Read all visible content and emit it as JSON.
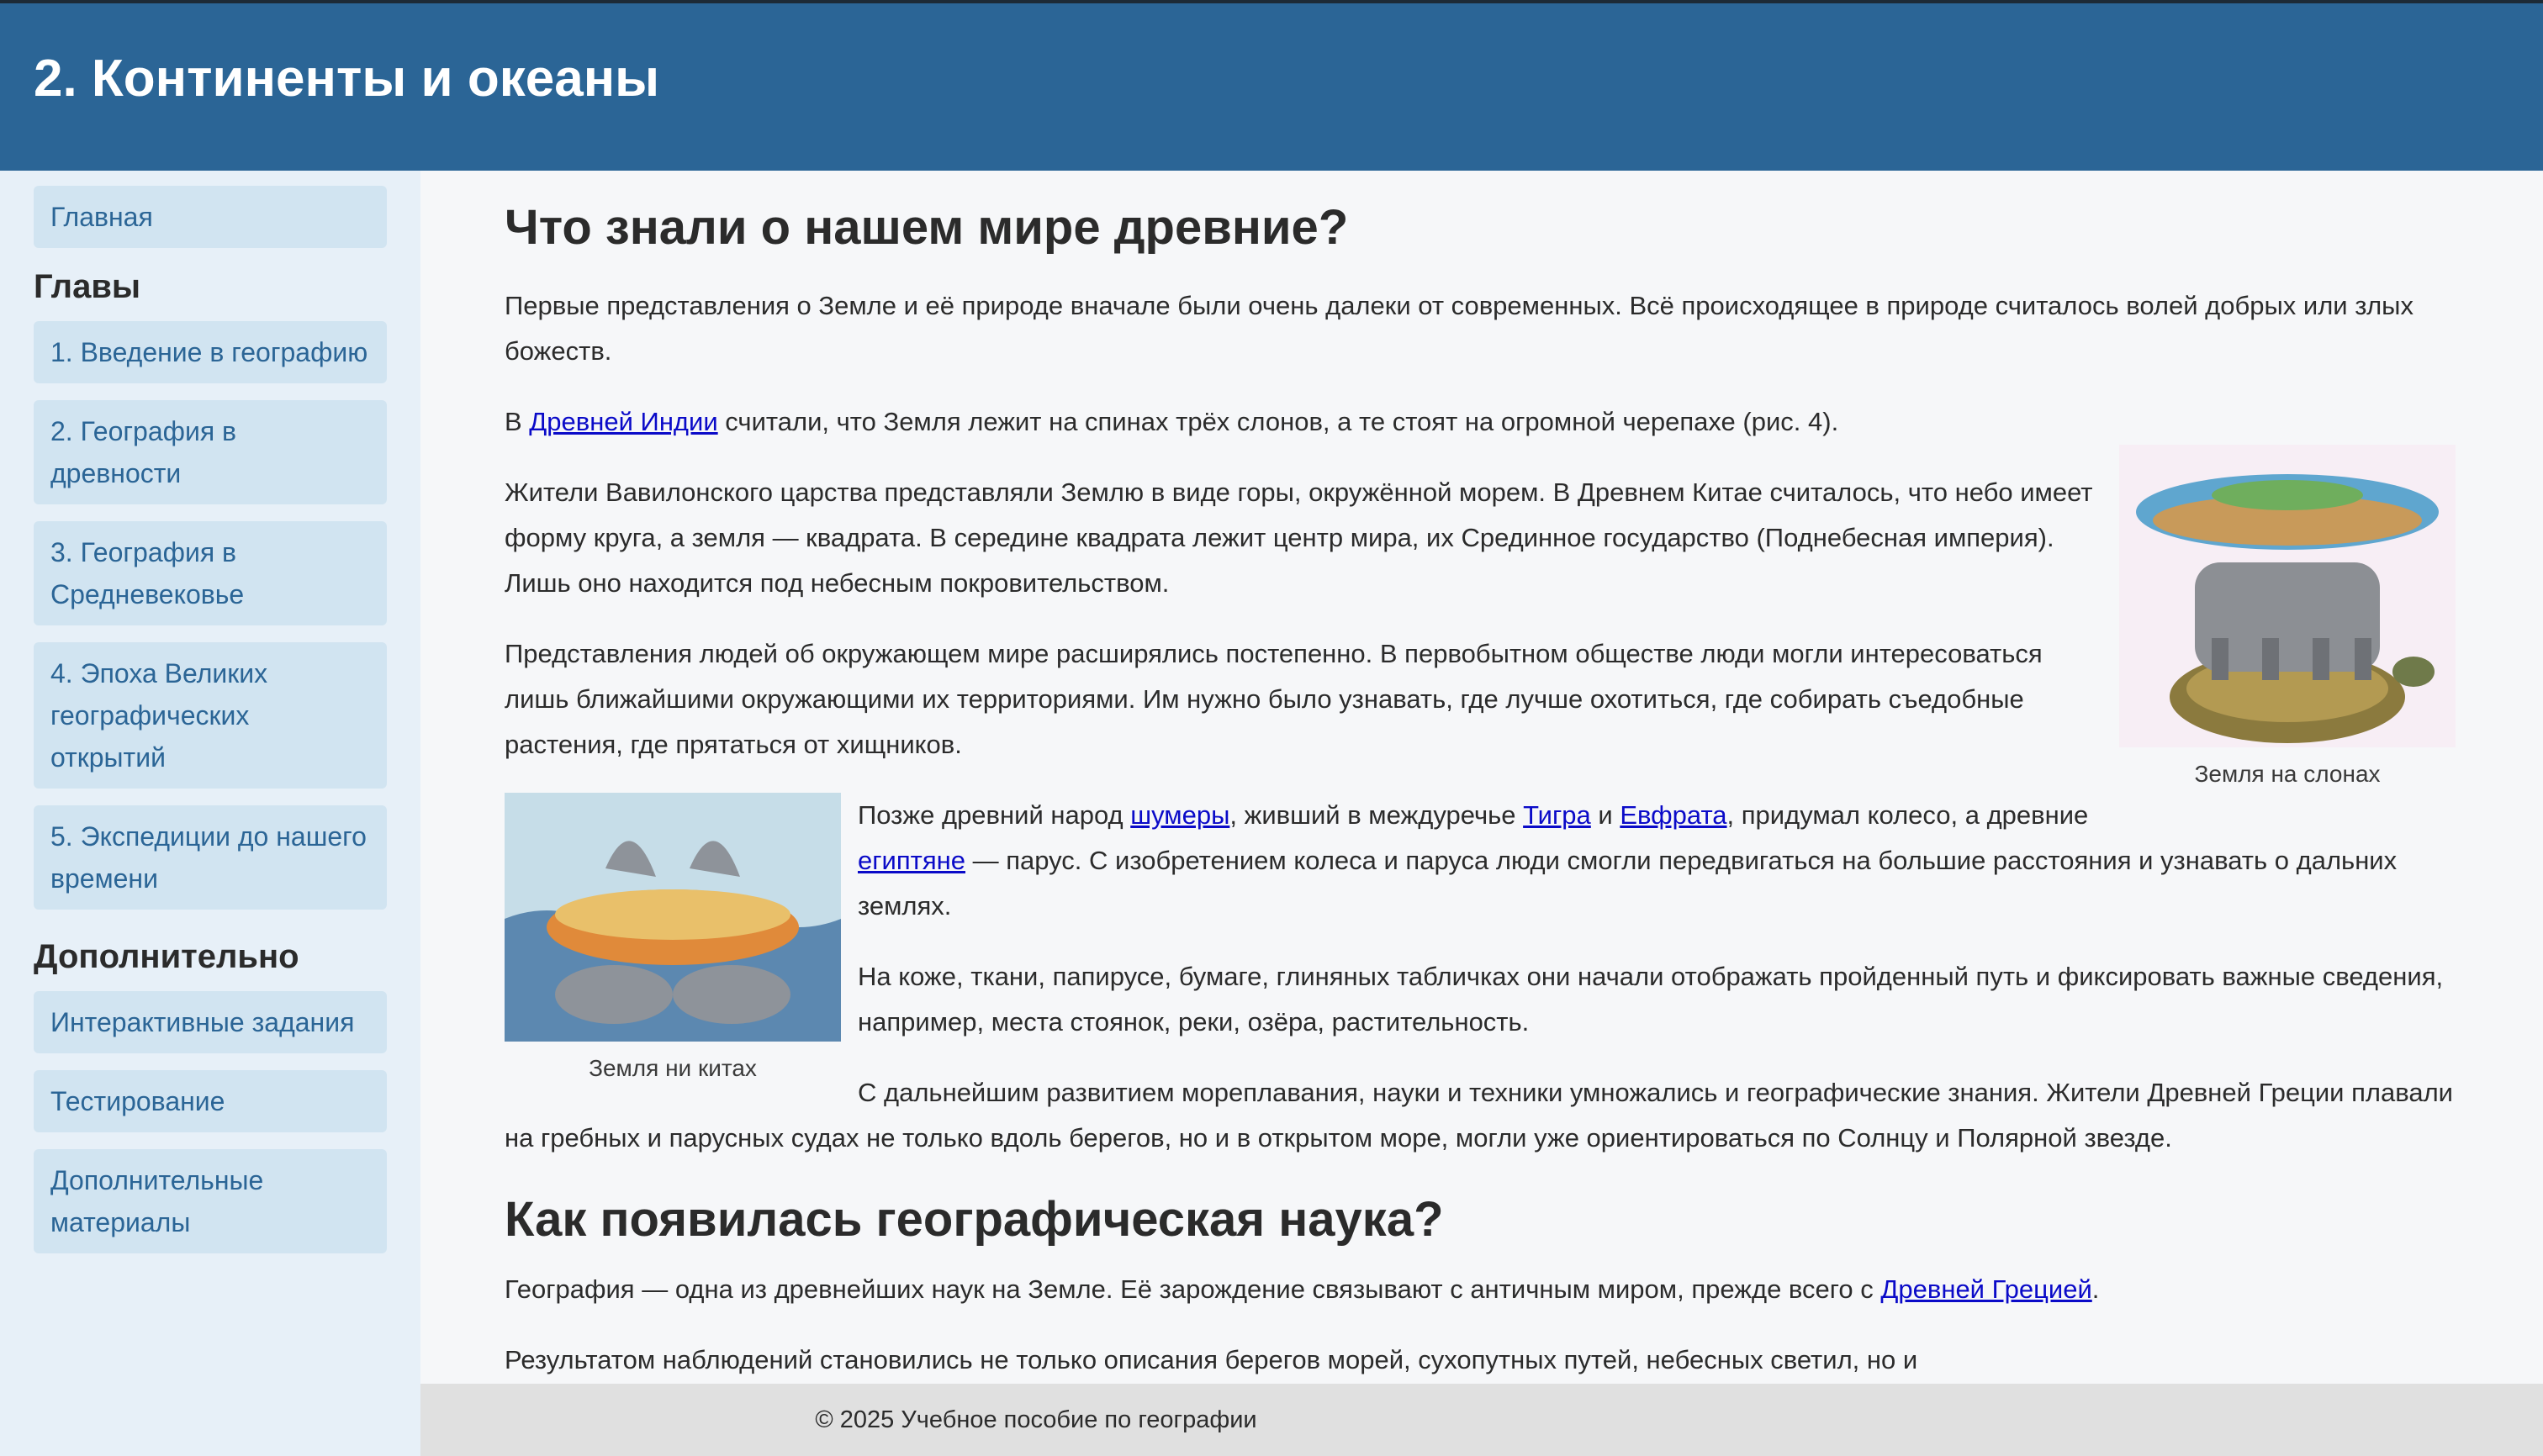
{
  "header": {
    "title": "2. Континенты и океаны"
  },
  "sidebar": {
    "home": "Главная",
    "chapters_heading": "Главы",
    "chapters": [
      "1. Введение в географию",
      "2. География в древности",
      "3. География в Средневековье",
      "4. Эпоха Великих географических открытий",
      "5. Экспедиции до нашего времени"
    ],
    "extra_heading": "Дополнительно",
    "extra": [
      "Интерактивные задания",
      "Тестирование",
      "Дополнительные материалы"
    ]
  },
  "main": {
    "h1": "Что знали о нашем мире древние?",
    "p1": "Первые представления о Земле и её природе вначале были очень далеки от современных. Всё происходящее в природе считалось волей добрых или злых божеств.",
    "p2_pre": "В ",
    "p2_link": "Древней Индии",
    "p2_post": " считали, что Земля лежит на спинах трёх слонов, а те стоят на огромной черепахе (рис. 4).",
    "fig1_caption": "Земля на слонах",
    "p3": "Жители Вавилонского царства представляли Землю в виде горы, окружённой морем. В Древнем Китае считалось, что небо имеет форму круга, а земля — квадрата. В середине квадрата лежит центр мира, их Срединное государство (Поднебесная империя). Лишь оно находится под небесным покровительством.",
    "p4": "Представления людей об окружающем мире расширялись постепенно. В первобытном обществе люди могли интересоваться лишь ближайшими окружающими их территориями. Им нужно было узнавать, где лучше охотиться, где собирать съедобные растения, где прятаться от хищников.",
    "fig2_caption": "Земля ни китах",
    "p5_a": "Позже древний народ ",
    "p5_link1": "шумеры",
    "p5_b": ", живший в междуречье ",
    "p5_link2": "Тигра",
    "p5_c": " и ",
    "p5_link3": "Евфрата",
    "p5_d": ", придумал колесо, а древние ",
    "p5_link4": "египтяне",
    "p5_e": " — парус. С изобретением колеса и паруса люди смогли передвигаться на большие расстояния и узнавать о дальних землях.",
    "p6": "На коже, ткани, папирусе, бумаге, глиняных табличках они начали отображать пройденный путь и фиксировать важные сведения, например, места стоянок, реки, озёра, растительность.",
    "p7": "С дальнейшим развитием мореплавания, науки и техники умножались и географические знания. Жители Древней Греции плавали на гребных и парусных судах не только вдоль берегов, но и в открытом море, могли уже ориентироваться по Солнцу и Полярной звезде.",
    "h2": "Как появилась географическая наука?",
    "p8_pre": "География — одна из древнейших наук на Земле. Её зарождение связывают с античным миром, прежде всего с ",
    "p8_link": "Древней Грецией",
    "p8_post": ".",
    "p9": "Результатом наблюдений становились не только описания берегов морей, сухопутных путей, небесных светил, но и"
  },
  "footer": {
    "text": "© 2025 Учебное пособие по географии"
  },
  "colors": {
    "header_bg": "#2b6596",
    "sidebar_bg": "#e7f0f8",
    "nav_btn_bg": "#d1e4f1",
    "link": "#0a0ac8"
  }
}
